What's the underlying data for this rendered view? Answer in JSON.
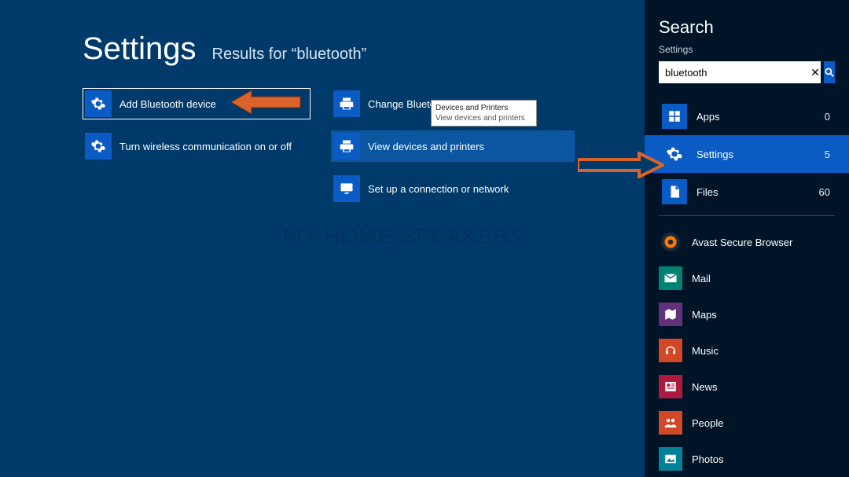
{
  "header": {
    "title": "Settings",
    "subtitle": "Results for “bluetooth”"
  },
  "results": {
    "col1": [
      {
        "label": "Add Bluetooth device",
        "icon": "gear"
      },
      {
        "label": "Turn wireless communication on or off",
        "icon": "gear"
      }
    ],
    "col2": [
      {
        "label": "Change Bluetooth settings",
        "icon": "printer"
      },
      {
        "label": "View devices and printers",
        "icon": "printer"
      },
      {
        "label": "Set up a connection or network",
        "icon": "network"
      }
    ]
  },
  "tooltip": {
    "title": "Devices and Printers",
    "body": "View devices and printers"
  },
  "watermark": "MY HOME SPEAKERS",
  "sidebar": {
    "title": "Search",
    "category_label": "Settings",
    "search_value": "bluetooth",
    "scopes": [
      {
        "label": "Apps",
        "count": "0",
        "icon": "apps"
      },
      {
        "label": "Settings",
        "count": "5",
        "icon": "gear"
      },
      {
        "label": "Files",
        "count": "60",
        "icon": "file"
      }
    ],
    "apps": [
      {
        "label": "Avast Secure Browser",
        "icon": "avast",
        "bg": "#001428"
      },
      {
        "label": "Mail",
        "icon": "mail",
        "bg": "#008272"
      },
      {
        "label": "Maps",
        "icon": "maps",
        "bg": "#62317a"
      },
      {
        "label": "Music",
        "icon": "music",
        "bg": "#d24726"
      },
      {
        "label": "News",
        "icon": "news",
        "bg": "#ae193e"
      },
      {
        "label": "People",
        "icon": "people",
        "bg": "#d24726"
      },
      {
        "label": "Photos",
        "icon": "photos",
        "bg": "#008299"
      }
    ]
  }
}
